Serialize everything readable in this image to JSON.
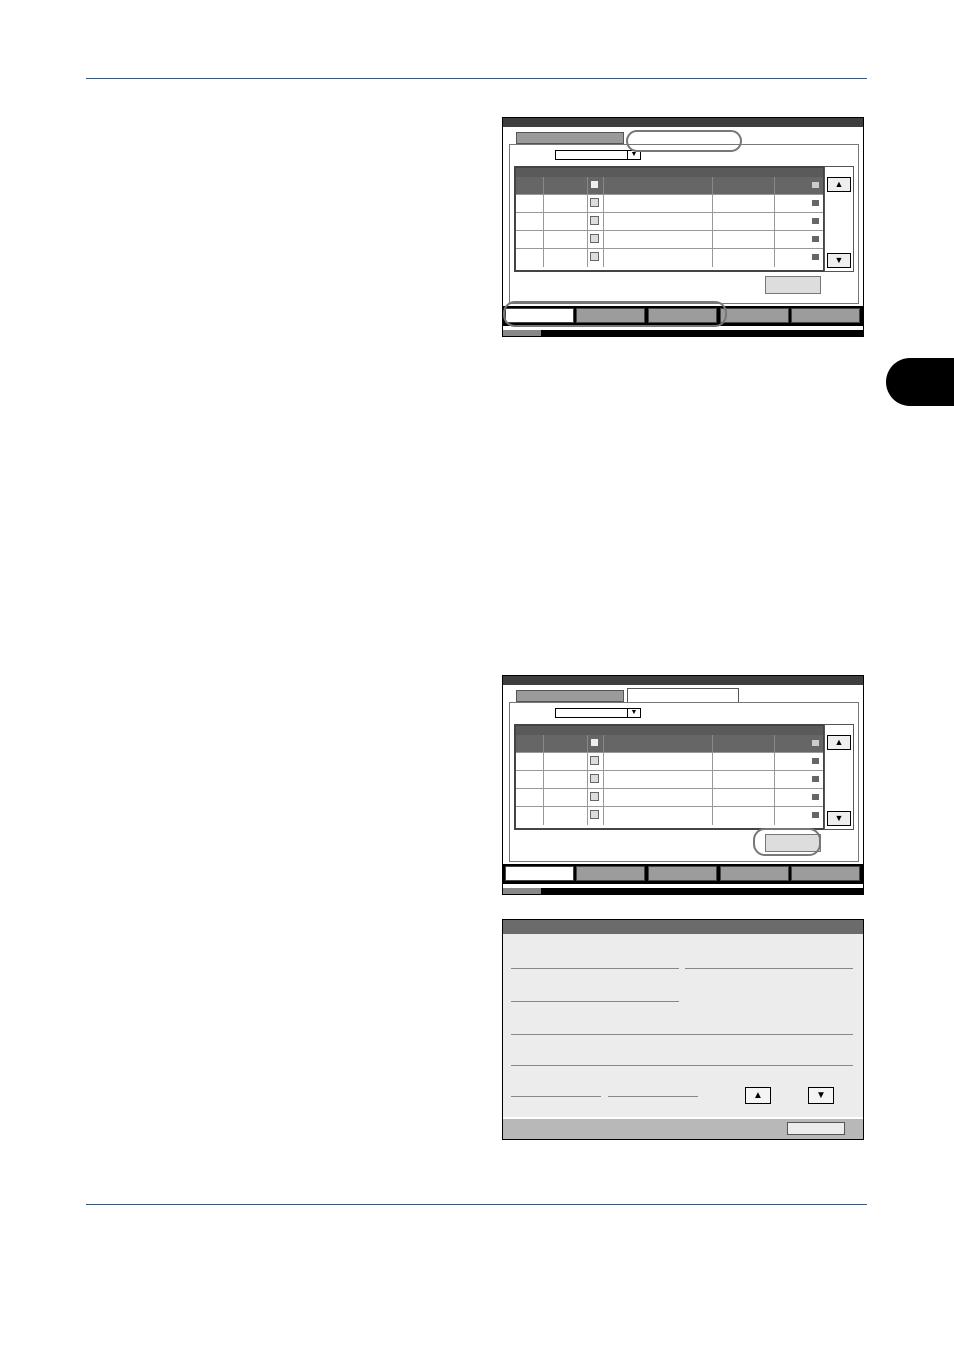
{
  "screens": [
    {
      "id": "screen-1",
      "dropdown_arrow_icon": "triangle-down-icon",
      "scroll_up_icon": "triangle-up-icon",
      "scroll_down_icon": "triangle-down-icon",
      "rows": 5,
      "highlighted": [
        "second-tab",
        "bottom-left-buttons"
      ]
    },
    {
      "id": "screen-2",
      "highlighted": [
        "list-action-button"
      ]
    },
    {
      "id": "screen-3",
      "scroll_up_icon": "triangle-up-icon",
      "scroll_down_icon": "triangle-down-icon"
    }
  ],
  "glyphs": {
    "up": "▲",
    "down": "▼"
  },
  "colors": {
    "rule": "#1f5fa8",
    "highlight_ring": "#777777"
  }
}
